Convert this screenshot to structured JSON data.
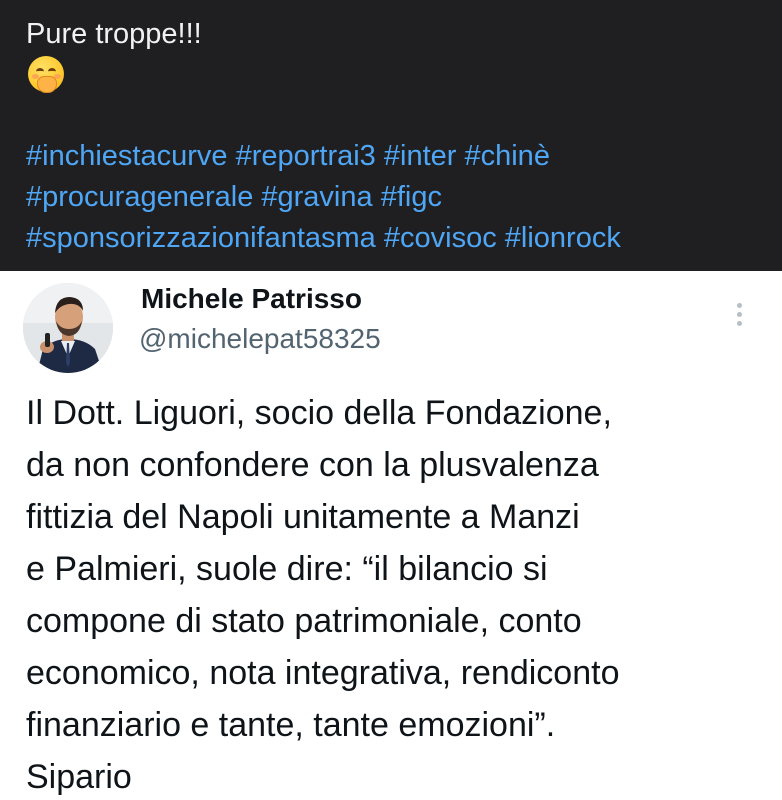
{
  "post": {
    "caption": "Pure troppe!!!",
    "emoji_name": "face-with-hand-over-mouth-emoji",
    "hashtag_lines": [
      [
        "#inchiestacurve",
        "#reportrai3",
        "#inter",
        "#chinè"
      ],
      [
        "#procuragenerale",
        "#gravina",
        "#figc"
      ],
      [
        "#sponsorizzazionifantasma",
        "#covisoc",
        "#lionrock"
      ]
    ],
    "colors": {
      "background": "#1f1f21",
      "text": "#f2f2f2",
      "hashtag": "#4ea6f5"
    }
  },
  "tweet": {
    "display_name": "Michele Patrisso",
    "handle": "@michelepat58325",
    "more_icon": "vertical-ellipsis-icon",
    "body_lines": [
      "Il Dott. Liguori, socio della Fondazione,",
      "da non confondere con la plusvalenza",
      "fittizia del Napoli unitamente a Manzi",
      "e Palmieri, suole dire: “il bilancio si",
      "compone di stato patrimoniale, conto",
      "economico, nota integrativa, rendiconto",
      "finanziario e tante, tante emozioni”.",
      "Sipario"
    ],
    "colors": {
      "name": "#0f1419",
      "handle": "#536471",
      "body": "#0f1419"
    }
  }
}
